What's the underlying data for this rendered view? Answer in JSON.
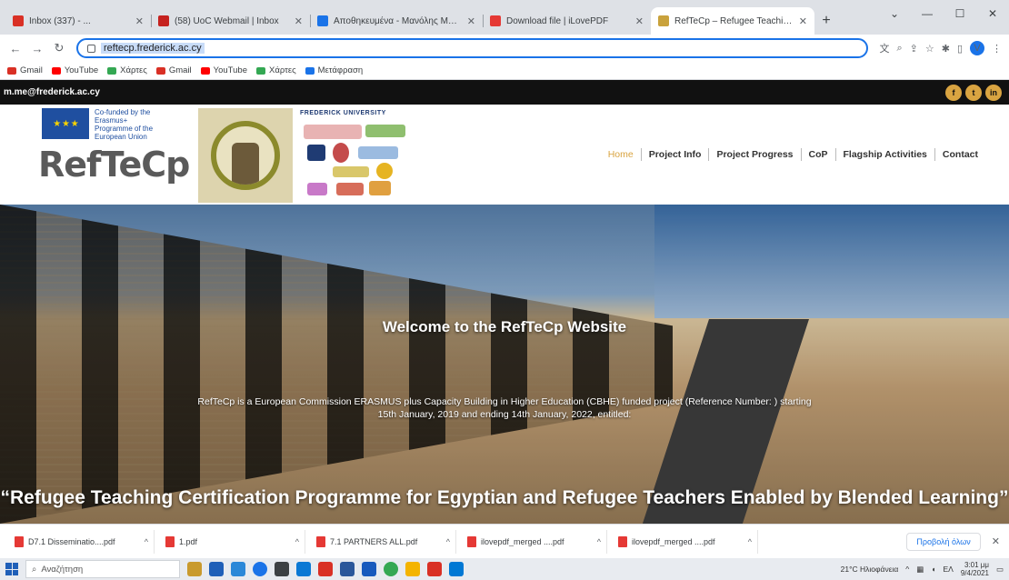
{
  "browser": {
    "tabs": [
      {
        "label": "Inbox (337) - ...",
        "favicon_color": "#d93025",
        "active": false
      },
      {
        "label": "(58) UoC Webmail | Inbox",
        "favicon_color": "#c5221f",
        "active": false
      },
      {
        "label": "Αποθηκευμένα - Μανόλης Μάκρα...",
        "favicon_color": "#1a73e8",
        "active": false
      },
      {
        "label": "Download file | iLovePDF",
        "favicon_color": "#e53935",
        "active": false
      },
      {
        "label": "RefTeCp – Refugee Teaching Cer...",
        "favicon_color": "#c9a23c",
        "active": true
      }
    ],
    "new_tab_symbol": "+",
    "window_controls": [
      "⌄",
      "—",
      "☐",
      "✕"
    ],
    "url": "reftecp.frederick.ac.cy",
    "profile_initial": "V",
    "bookmarks": [
      {
        "label": "Gmail",
        "icon_color": "#d93025"
      },
      {
        "label": "YouTube",
        "icon_color": "#ff0000"
      },
      {
        "label": "Χάρτες",
        "icon_color": "#34a853"
      },
      {
        "label": "Gmail",
        "icon_color": "#d93025"
      },
      {
        "label": "YouTube",
        "icon_color": "#ff0000"
      },
      {
        "label": "Χάρτες",
        "icon_color": "#34a853"
      },
      {
        "label": "Μετάφραση",
        "icon_color": "#1a73e8"
      }
    ]
  },
  "site": {
    "contact_email": "m.me@frederick.ac.cy",
    "socials": [
      "f",
      "t",
      "in"
    ],
    "eu_text": "Co-funded by the Erasmus+ Programme of the European Union",
    "eu_stars": "★ ★ ★",
    "brand": "RefTeCp",
    "university_label": "FREDERICK UNIVERSITY",
    "nav": [
      {
        "label": "Home",
        "active": true
      },
      {
        "label": "Project Info",
        "active": false
      },
      {
        "label": "Project Progress",
        "active": false
      },
      {
        "label": "CoP",
        "active": false
      },
      {
        "label": "Flagship Activities",
        "active": false
      },
      {
        "label": "Contact",
        "active": false
      }
    ],
    "hero": {
      "title": "Welcome to the RefTeCp Website",
      "body": "RefTeCp is a European Commission ERASMUS plus Capacity Building in Higher Education (CBHE) funded project (Reference Number: ) starting 15th January, 2019 and ending 14th January, 2022, entitled:",
      "quote": "“Refugee Teaching Certification Programme for Egyptian and Refugee Teachers Enabled by Blended Learning”"
    }
  },
  "downloads": {
    "items": [
      "D7.1 Disseminatio....pdf",
      "1.pdf",
      "7.1 PARTNERS ALL.pdf",
      "ilovepdf_merged ....pdf",
      "ilovepdf_merged ....pdf"
    ],
    "show_all": "Προβολή όλων"
  },
  "taskbar": {
    "search_placeholder": "Αναζήτηση",
    "apps": [
      "#c99a2e",
      "#1f5fb8",
      "#2b88d8",
      "#1a73e8",
      "#3c4043",
      "#0a78d4",
      "#d93025",
      "#2b579a",
      "#185abd",
      "#34a853",
      "#f4b400",
      "#d93025",
      "#0078d4"
    ],
    "weather": "21°C Ηλιοφάνεια",
    "lang": "ΕΛ",
    "time": "3:01 μμ",
    "date": "9/4/2021"
  }
}
